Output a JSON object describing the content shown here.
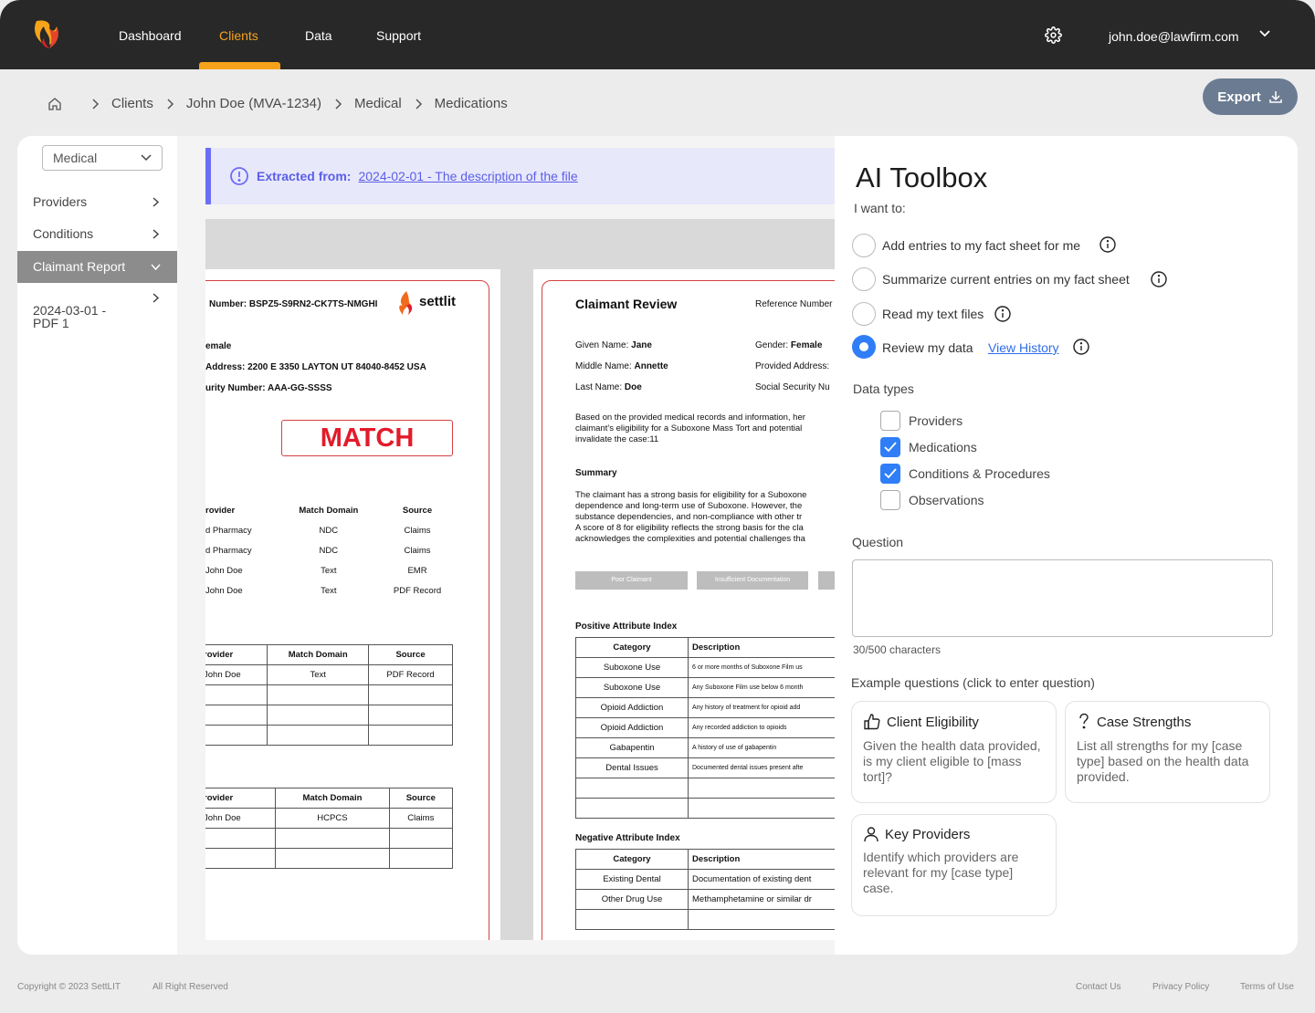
{
  "nav": {
    "items": [
      "Dashboard",
      "Clients",
      "Data",
      "Support"
    ],
    "active": "Clients",
    "user_email": "john.doe@lawfirm.com"
  },
  "breadcrumb": [
    "Clients",
    "John Doe (MVA-1234)",
    "Medical",
    "Medications"
  ],
  "export_label": "Export",
  "sidebar": {
    "select_value": "Medical",
    "items": [
      {
        "label": "Providers"
      },
      {
        "label": "Conditions"
      },
      {
        "label": "Claimant Report"
      },
      {
        "label": "2024-03-01 -\nPDF 1"
      }
    ]
  },
  "banner": {
    "label": "Extracted from:",
    "link": "2024-02-01 - The description of the file"
  },
  "doc1": {
    "number_line": "Number: BSPZ5-S9RN2-CK7TS-NMGHI",
    "brand": "settlit",
    "sex_line": "emale",
    "address_line": "Address: 2200 E 3350 LAYTON UT 84040-8452 USA",
    "ssn_line": "urity Number: AAA-GG-SSSS",
    "match": "MATCH",
    "table1": {
      "headers": [
        "rovider",
        "Match Domain",
        "Source"
      ],
      "rows": [
        [
          "d Pharmacy",
          "NDC",
          "Claims"
        ],
        [
          "d Pharmacy",
          "NDC",
          "Claims"
        ],
        [
          "John Doe",
          "Text",
          "EMR"
        ],
        [
          "John Doe",
          "Text",
          "PDF Record"
        ]
      ]
    },
    "table2": {
      "headers": [
        "rovider",
        "Match Domain",
        "Source"
      ],
      "rows": [
        [
          "John Doe",
          "Text",
          "PDF Record"
        ],
        [
          "",
          "",
          ""
        ],
        [
          "",
          "",
          ""
        ],
        [
          "",
          "",
          ""
        ]
      ]
    },
    "table3": {
      "headers": [
        "rovider",
        "Match Domain",
        "Source"
      ],
      "rows": [
        [
          "John Doe",
          "HCPCS",
          "Claims"
        ],
        [
          "",
          "",
          ""
        ],
        [
          "",
          "",
          ""
        ],
        [
          "",
          "",
          ""
        ]
      ]
    }
  },
  "doc2": {
    "title": "Claimant Review",
    "ref_label": "Reference Number",
    "given_name_label": "Given Name:",
    "given_name": "Jane",
    "gender_label": "Gender:",
    "gender": "Female",
    "middle_name_label": "Middle Name:",
    "middle_name": "Annette",
    "provided_address_label": "Provided Address:",
    "last_name_label": "Last Name:",
    "last_name": "Doe",
    "ssn_label": "Social Security Nu",
    "intro": "Based on the provided medical records and information, her\nclaimant's eligibility for a Suboxone Mass Tort and potential\ninvalidate the case:11",
    "summary_title": "Summary",
    "summary": "The claimant has a strong basis for eligibility for a Suboxone\ndependence and long-term use of Suboxone. However, the\nsubstance dependencies, and non-compliance with other tr\nA score of 8 for eligibility reflects the strong basis for the cla\nacknowledges the complexities and potential challenges tha",
    "tags": [
      "Poor Claimant",
      "Insufficient Documentation"
    ],
    "pos_title": "Positive Attribute Index",
    "pos_headers": [
      "Category",
      "Description"
    ],
    "pos_rows": [
      [
        "Suboxone Use",
        "6 or more months of Suboxone Film us"
      ],
      [
        "Suboxone Use",
        "Any Suboxone Film use below 6 month"
      ],
      [
        "Opioid Addiction",
        "Any history of treatment for opioid add"
      ],
      [
        "Opioid Addiction",
        "Any recorded addiction to opioids"
      ],
      [
        "Gabapentin",
        "A history of use of gabapentin"
      ],
      [
        "Dental Issues",
        "Documented dental issues present afte"
      ],
      [
        "",
        ""
      ],
      [
        "",
        ""
      ]
    ],
    "neg_title": "Negative Attribute Index",
    "neg_headers": [
      "Category",
      "Description"
    ],
    "neg_rows": [
      [
        "Existing Dental",
        "Documentation of existing dent"
      ],
      [
        "Other Drug Use",
        "Methamphetamine or similar dr"
      ],
      [
        "",
        ""
      ]
    ]
  },
  "toolbox": {
    "title": "AI Toolbox",
    "want_label": "I want to:",
    "options": [
      "Add entries to my fact sheet for me",
      "Summarize current entries on my fact sheet",
      "Read my text files",
      "Review my data"
    ],
    "selected_option": "Review my data",
    "view_history": "View History",
    "data_types_label": "Data types",
    "data_types": [
      {
        "label": "Providers",
        "checked": false
      },
      {
        "label": "Medications",
        "checked": true
      },
      {
        "label": "Conditions & Procedures",
        "checked": true
      },
      {
        "label": "Observations",
        "checked": false
      }
    ],
    "question_label": "Question",
    "question_value": "",
    "char_count": "30/500 characters",
    "examples_label": "Example questions (click to enter question)",
    "examples": [
      {
        "title": "Client Eligibility",
        "icon": "thumbs-up-icon",
        "body": "Given the health data provided, is my client eligible to [mass tort]?"
      },
      {
        "title": "Case Strengths",
        "icon": "question-mark-icon",
        "body": "List all strengths for my [case type] based on the health data provided."
      },
      {
        "title": "Key Providers",
        "icon": "user-icon",
        "body": "Identify which providers are relevant for my [case type] case."
      }
    ]
  },
  "footer": {
    "copyright": "Copyright © 2023 SettLIT",
    "rights": "All Right Reserved",
    "links": [
      "Contact Us",
      "Privacy Policy",
      "Terms of Use"
    ]
  },
  "colors": {
    "accent": "#f7a21b",
    "primary": "#2f7ef7",
    "match": "#e21b2a",
    "banner": "#6a6ef5"
  }
}
